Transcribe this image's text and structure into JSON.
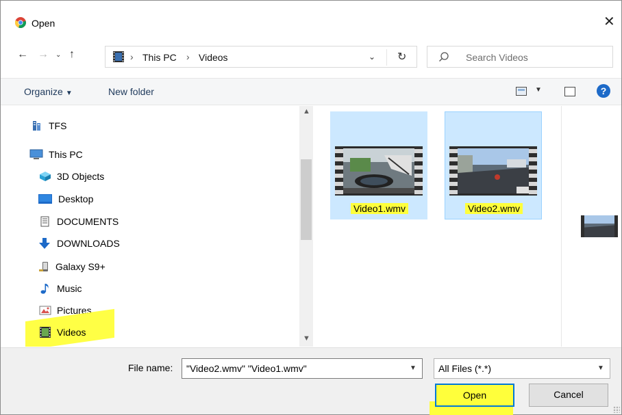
{
  "window": {
    "title": "Open",
    "close_label": "✕"
  },
  "address": {
    "crumbs": [
      "This PC",
      "Videos"
    ],
    "separator": "›",
    "search_placeholder": "Search Videos"
  },
  "toolbar": {
    "organize_label": "Organize",
    "new_folder_label": "New folder",
    "help_label": "?"
  },
  "nav": {
    "items": [
      {
        "label": "TFS",
        "icon": "server-icon"
      },
      {
        "label": "This PC",
        "icon": "computer-icon"
      },
      {
        "label": "3D Objects",
        "icon": "cube-icon"
      },
      {
        "label": "Desktop",
        "icon": "desktop-icon"
      },
      {
        "label": "DOCUMENTS",
        "icon": "document-icon"
      },
      {
        "label": "DOWNLOADS",
        "icon": "download-icon"
      },
      {
        "label": "Galaxy S9+",
        "icon": "phone-icon"
      },
      {
        "label": "Music",
        "icon": "music-note-icon"
      },
      {
        "label": "Pictures",
        "icon": "picture-icon"
      },
      {
        "label": "Videos",
        "icon": "film-icon"
      }
    ],
    "selected": "Videos"
  },
  "files": [
    {
      "name": "Video1.wmv"
    },
    {
      "name": "Video2.wmv"
    }
  ],
  "bottom": {
    "file_name_label": "File name:",
    "file_name_value": "\"Video2.wmv\" \"Video1.wmv\"",
    "file_type_value": "All Files (*.*)",
    "open_label": "Open",
    "cancel_label": "Cancel"
  },
  "colors": {
    "accent": "#0078d7",
    "selection": "#cce8ff",
    "highlight": "#ffff3b"
  }
}
